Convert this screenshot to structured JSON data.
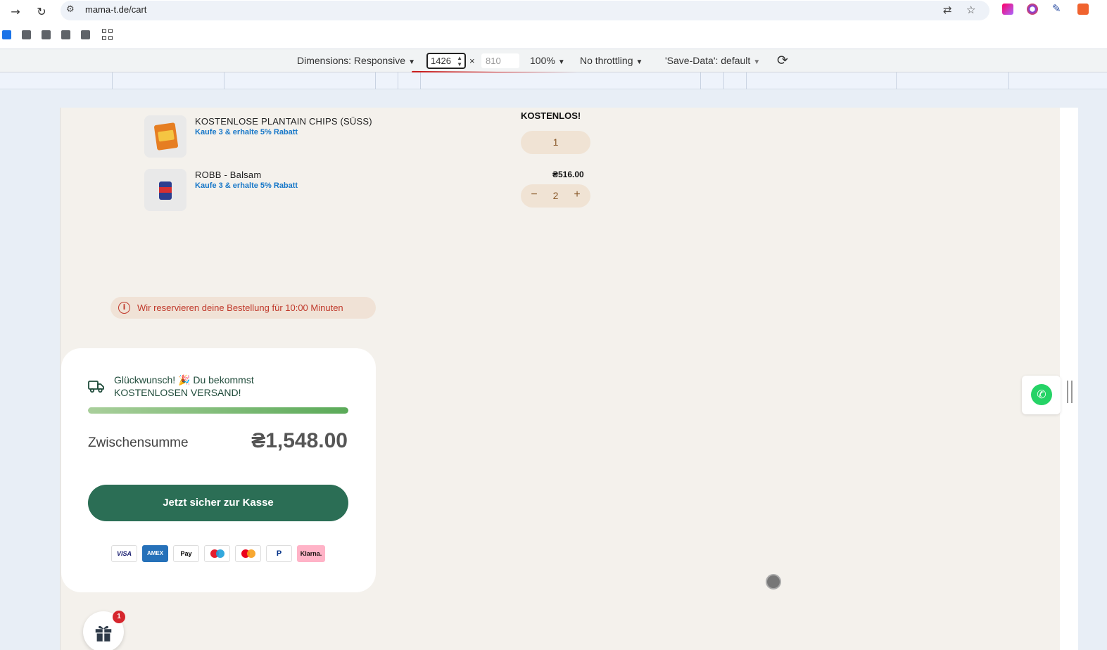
{
  "browser": {
    "url": "mama-t.de/cart"
  },
  "device_toolbar": {
    "dimensions_label": "Dimensions: Responsive",
    "width_value": "1426",
    "separator": "×",
    "height_placeholder": "810",
    "zoom": "100%",
    "throttling": "No throttling",
    "save_data": "'Save-Data': default"
  },
  "cart": {
    "items": [
      {
        "title": "KOSTENLOSE PLANTAIN CHIPS (SÜSS)",
        "promo": "Kaufe 3 & erhalte 5% Rabatt",
        "price": "KOSTENLOS!",
        "quantity": "1"
      },
      {
        "title": "ROBB - Balsam",
        "promo": "Kaufe 3 & erhalte 5% Rabatt",
        "price": "₴516.00",
        "quantity": "2",
        "minus": "−",
        "plus": "+"
      }
    ],
    "reservation_notice": "Wir reservieren deine Bestellung für 10:00 Minuten",
    "shipping_line1": "Glückwunsch! 🎉 Du bekommst",
    "shipping_line2": "KOSTENLOSEN VERSAND!",
    "shipping_progress": 1.0,
    "subtotal_label": "Zwischensumme",
    "subtotal_value": "₴1,548.00",
    "checkout_label": "Jetzt sicher zur Kasse",
    "payment_methods": [
      "VISA",
      "AMEX",
      "Pay",
      "Maestro",
      "Mastercard",
      "PayPal",
      "Klarna."
    ]
  },
  "gift": {
    "badge": "1"
  },
  "colors": {
    "accent_green": "#2b6e55",
    "promo_blue": "#1677c8",
    "notice_red": "#c0392b",
    "page_bg": "#f4f1ec"
  }
}
